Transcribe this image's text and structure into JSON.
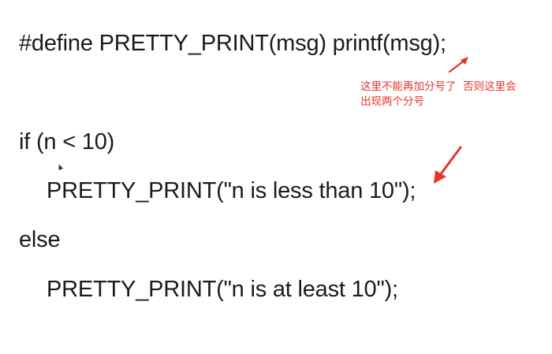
{
  "code": {
    "define_line": "#define PRETTY_PRINT(msg) printf(msg);",
    "if_line": "if (n < 10)",
    "pretty_print_1": "PRETTY_PRINT(\"n is less than 10\");",
    "else_line": "else",
    "pretty_print_2": "PRETTY_PRINT(\"n is at least 10\");"
  },
  "annotation": {
    "text": "这里不能再加分号了  否则这里会\n出现两个分号",
    "color": "#e8332b"
  },
  "icons": {
    "arrow_1": "red-arrow-icon",
    "arrow_2": "red-arrow-icon",
    "cursor": "mouse-cursor-icon"
  }
}
